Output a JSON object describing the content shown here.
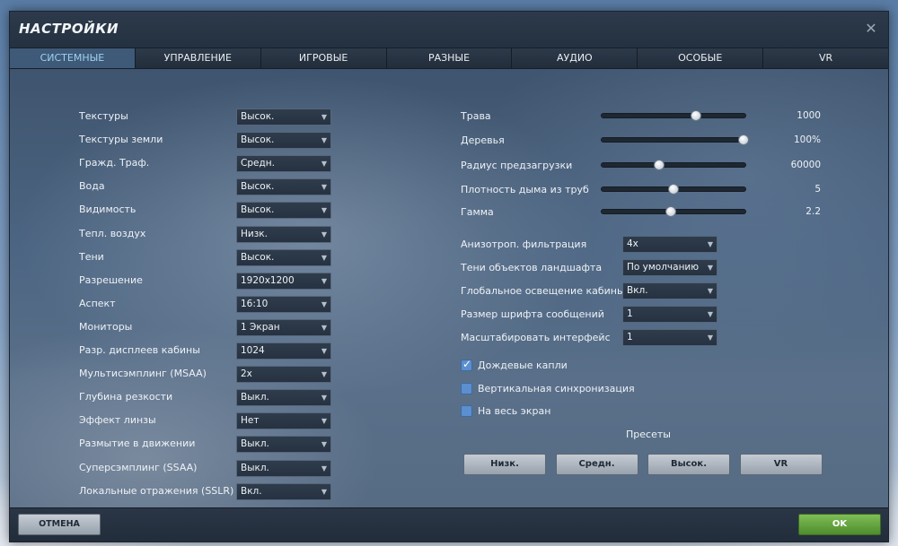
{
  "window": {
    "title": "НАСТРОЙКИ",
    "close_glyph": "✕"
  },
  "tabs": [
    {
      "label": "СИСТЕМНЫЕ",
      "active": true
    },
    {
      "label": "УПРАВЛЕНИЕ",
      "active": false
    },
    {
      "label": "ИГРОВЫЕ",
      "active": false
    },
    {
      "label": "РАЗНЫЕ",
      "active": false
    },
    {
      "label": "АУДИО",
      "active": false
    },
    {
      "label": "ОСОБЫЕ",
      "active": false
    },
    {
      "label": "VR",
      "active": false
    }
  ],
  "left_settings": [
    {
      "label": "Текстуры",
      "value": "Высок."
    },
    {
      "label": "Текстуры земли",
      "value": "Высок."
    },
    {
      "label": "Гражд. Траф.",
      "value": "Средн."
    },
    {
      "label": "Вода",
      "value": "Высок."
    },
    {
      "label": "Видимость",
      "value": "Высок."
    },
    {
      "label": "Тепл. воздух",
      "value": "Низк."
    },
    {
      "label": "Тени",
      "value": "Высок."
    },
    {
      "label": "Разрешение",
      "value": "1920x1200"
    },
    {
      "label": "Аспект",
      "value": "16:10"
    },
    {
      "label": "Мониторы",
      "value": "1 Экран"
    },
    {
      "label": "Разр. дисплеев кабины",
      "value": "1024"
    },
    {
      "label": "Мультисэмплинг (MSAA)",
      "value": "2x"
    },
    {
      "label": "Глубина резкости",
      "value": "Выкл."
    },
    {
      "label": "Эффект линзы",
      "value": "Нет"
    },
    {
      "label": "Размытие в движении",
      "value": "Выкл."
    },
    {
      "label": "Суперсэмплинг (SSAA)",
      "value": "Выкл."
    },
    {
      "label": "Локальные отражения (SSLR)",
      "value": "Вкл."
    }
  ],
  "sliders": [
    {
      "label": "Трава",
      "value": "1000",
      "fraction": 0.66
    },
    {
      "label": "Деревья",
      "value": "100%",
      "fraction": 1.0
    },
    {
      "label": "Радиус предзагрузки",
      "value": "60000",
      "fraction": 0.4
    },
    {
      "label": "Плотность дыма из труб",
      "value": "5",
      "fraction": 0.5
    },
    {
      "label": "Гамма",
      "value": "2.2",
      "fraction": 0.48
    }
  ],
  "right_settings": [
    {
      "label": "Анизотроп. фильтрация",
      "value": "4x"
    },
    {
      "label": "Тени объектов ландшафта",
      "value": "По умолчанию"
    },
    {
      "label": "Глобальное освещение кабины",
      "value": "Вкл."
    },
    {
      "label": "Размер шрифта сообщений",
      "value": "1"
    },
    {
      "label": "Масштабировать интерфейс",
      "value": "1"
    }
  ],
  "checkboxes": [
    {
      "label": "Дождевые капли",
      "checked": true
    },
    {
      "label": "Вертикальная синхронизация",
      "checked": false
    },
    {
      "label": "На весь экран",
      "checked": false
    }
  ],
  "presets": {
    "title": "Пресеты",
    "buttons": [
      "Низк.",
      "Средн.",
      "Высок.",
      "VR"
    ]
  },
  "footer": {
    "cancel_label": "ОТМЕНА",
    "ok_label": "OK"
  },
  "icons": {
    "dropdown_arrow": "chevron-down-icon",
    "close": "close-icon",
    "checkmark": "check-icon"
  },
  "colors": {
    "active_tab_text": "#9fd0f0",
    "ok_button": "#5a9a35",
    "checkbox": "#5b8fcf"
  }
}
